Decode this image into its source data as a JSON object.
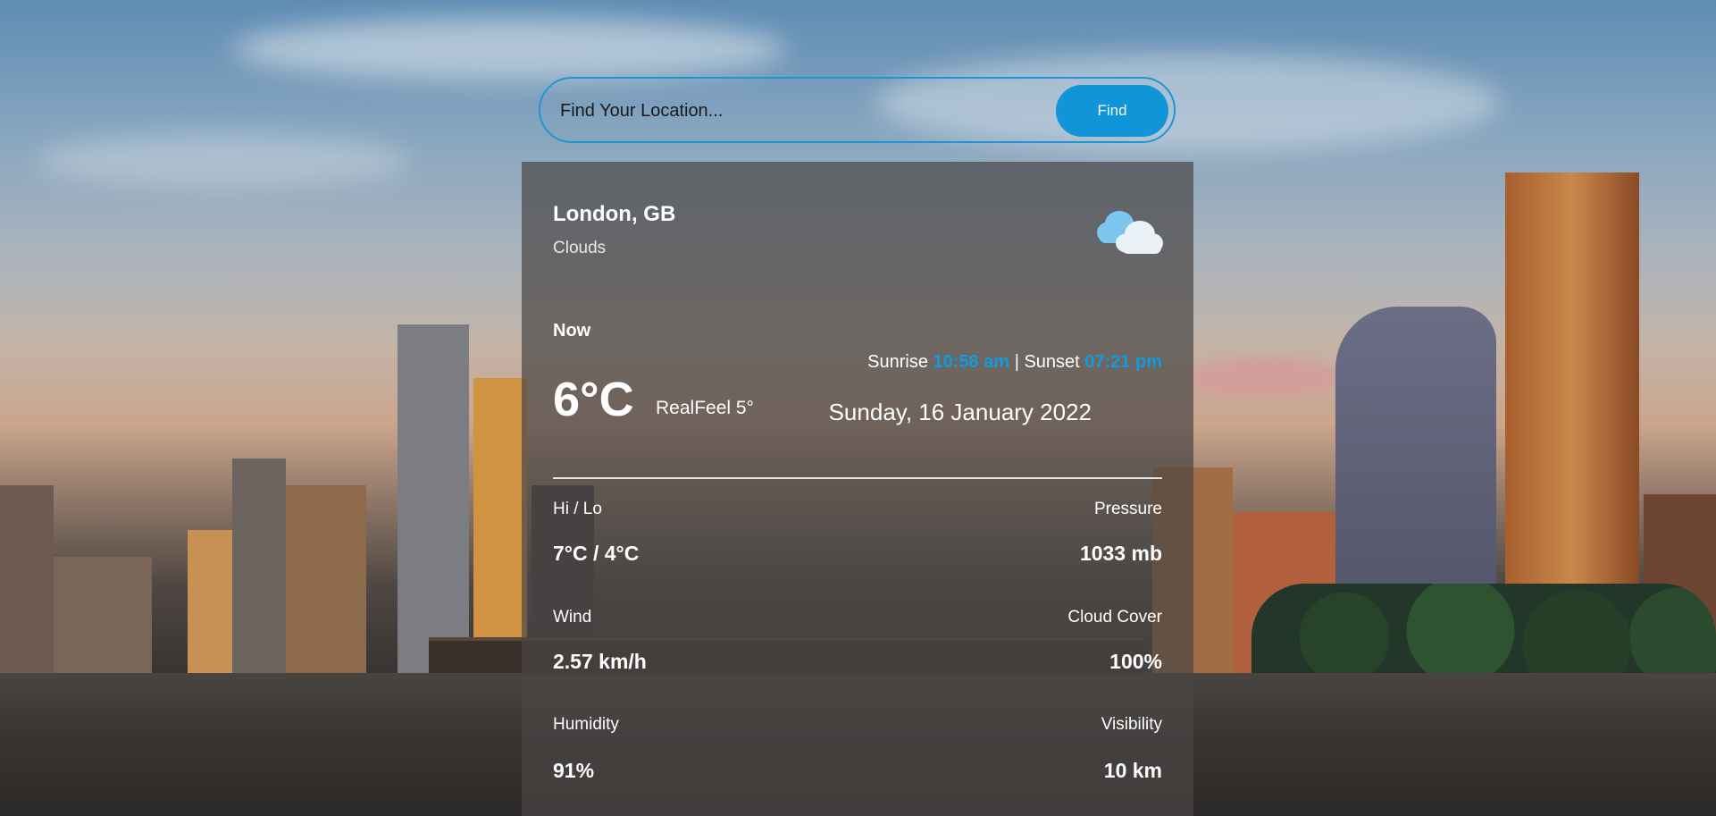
{
  "search": {
    "placeholder": "Find Your Location...",
    "button_label": "Find"
  },
  "weather": {
    "location": "London, GB",
    "condition": "Clouds",
    "icon": "cloud-icon",
    "now_label": "Now",
    "temperature": "6°C",
    "realfeel": "RealFeel 5°",
    "sunrise_label": "Sunrise",
    "sunrise_time": "10:58 am",
    "separator": "|",
    "sunset_label": "Sunset",
    "sunset_time": "07:21 pm",
    "date": "Sunday, 16 January 2022",
    "stats": {
      "hilo_label": "Hi / Lo",
      "hilo_value": "7°C / 4°C",
      "pressure_label": "Pressure",
      "pressure_value": "1033 mb",
      "wind_label": "Wind",
      "wind_value": "2.57 km/h",
      "cloud_label": "Cloud Cover",
      "cloud_value": "100%",
      "humidity_label": "Humidity",
      "humidity_value": "91%",
      "visibility_label": "Visibility",
      "visibility_value": "10 km"
    }
  },
  "colors": {
    "accent": "#0f95d8",
    "highlight": "#139be0",
    "panel": "#484644"
  }
}
